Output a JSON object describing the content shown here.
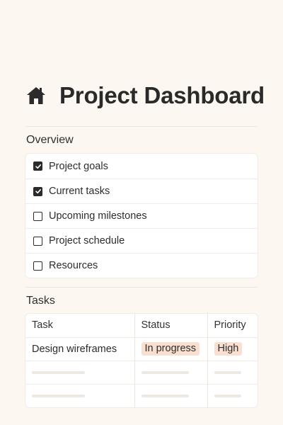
{
  "header": {
    "icon": "home-icon",
    "title": "Project Dashboard"
  },
  "overview": {
    "title": "Overview",
    "items": [
      {
        "label": "Project goals",
        "checked": true
      },
      {
        "label": "Current tasks",
        "checked": true
      },
      {
        "label": "Upcoming milestones",
        "checked": false
      },
      {
        "label": "Project schedule",
        "checked": false
      },
      {
        "label": "Resources",
        "checked": false
      }
    ]
  },
  "tasks": {
    "title": "Tasks",
    "columns": [
      "Task",
      "Status",
      "Priority"
    ],
    "rows": [
      {
        "task": "Design wireframes",
        "status": "In progress",
        "priority": "High"
      }
    ],
    "colors": {
      "badge_bg": "#f9dfd0"
    }
  },
  "theme": {
    "background": "#fcf7f1",
    "text": "#2b2b2b"
  }
}
